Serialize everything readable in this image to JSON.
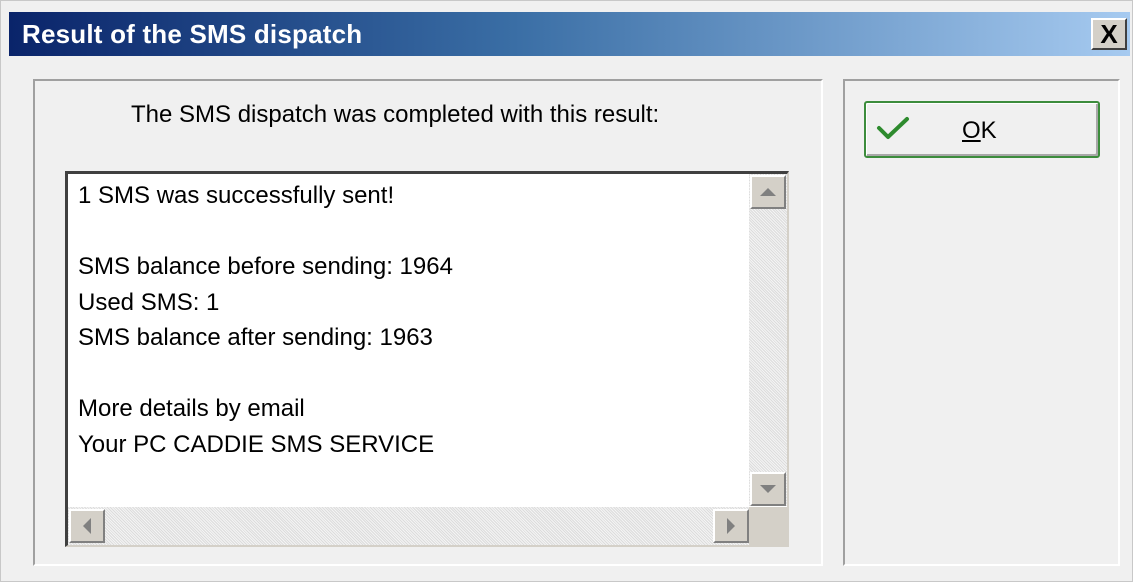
{
  "window": {
    "title": "Result of the SMS dispatch",
    "close_label": "X"
  },
  "main": {
    "message": "The SMS dispatch was completed with this result:",
    "result_lines": [
      "1 SMS was successfully sent!",
      "",
      "SMS balance before sending: 1964",
      "Used SMS: 1",
      "SMS balance after sending: 1963",
      "",
      "More details by email",
      "Your PC CADDIE SMS SERVICE"
    ]
  },
  "actions": {
    "ok_accel": "O",
    "ok_rest": "K",
    "ok_icon": "checkmark-icon"
  },
  "colors": {
    "title_gradient_start": "#0a246a",
    "title_gradient_end": "#a6caf0",
    "ok_border": "#3c8c3c",
    "checkmark": "#2e8b2e"
  }
}
